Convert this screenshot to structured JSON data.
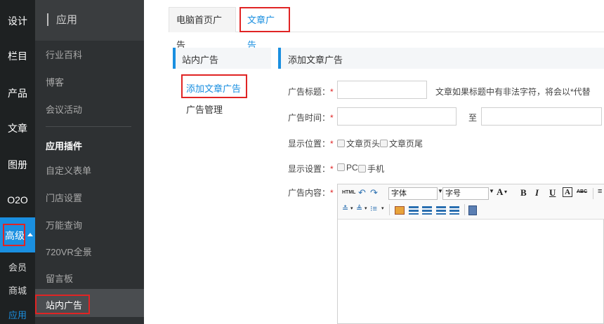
{
  "rail": {
    "items": [
      {
        "label": "设计"
      },
      {
        "label": "栏目"
      },
      {
        "label": "产品"
      },
      {
        "label": "文章"
      },
      {
        "label": "图册"
      },
      {
        "label": "O2O"
      },
      {
        "label": "高级"
      }
    ],
    "sub_items": [
      {
        "label": "会员"
      },
      {
        "label": "商城"
      },
      {
        "label": "应用"
      }
    ]
  },
  "menu2": {
    "title": "应用",
    "items": [
      {
        "label": "行业百科"
      },
      {
        "label": "博客"
      },
      {
        "label": "会议活动"
      },
      {
        "label": "应用插件"
      },
      {
        "label": "自定义表单"
      },
      {
        "label": "门店设置"
      },
      {
        "label": "万能查询"
      },
      {
        "label": "720VR全景"
      },
      {
        "label": "留言板"
      },
      {
        "label": "站内广告"
      }
    ]
  },
  "tabs": [
    {
      "label": "电脑首页广告"
    },
    {
      "label": "文章广告"
    }
  ],
  "left_panel": {
    "title": "站内广告",
    "links": [
      {
        "label": "添加文章广告"
      },
      {
        "label": "广告管理"
      }
    ]
  },
  "form": {
    "title": "添加文章广告",
    "required_mark": "*",
    "fields": {
      "ad_title_label": "广告标题：",
      "ad_title_note": "文章如果标题中有非法字符，将会以*代替",
      "ad_time_label": "广告时间：",
      "ad_time_to": "至",
      "position_label": "显示位置：",
      "position_opt1": "文章页头",
      "position_opt2": "文章页尾",
      "display_label": "显示设置：",
      "display_opt1": "PC",
      "display_opt2": "手机",
      "content_label": "广告内容："
    }
  },
  "editor": {
    "html_label": "HTML",
    "font_label": "字体",
    "size_label": "号",
    "size_prefix": "字",
    "A_label": "A",
    "B_label": "B",
    "I_label": "I",
    "U_label": "U",
    "box_A_label": "A",
    "abc_label": "ABC"
  },
  "colors": {
    "accent": "#1a8fe0",
    "highlight_outline": "#e02424",
    "rail_bg": "#1e2122",
    "menu_bg": "#2e3133"
  }
}
